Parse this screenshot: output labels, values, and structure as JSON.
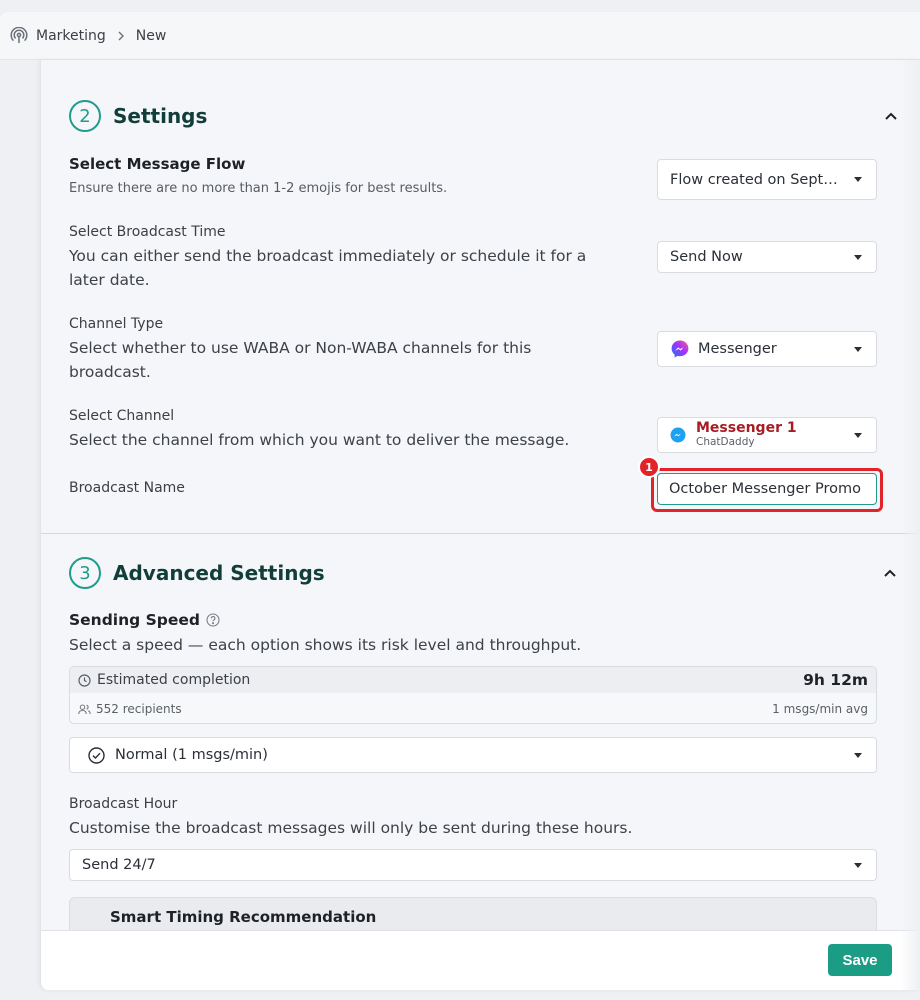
{
  "breadcrumb": {
    "section": "Marketing",
    "current": "New"
  },
  "settings": {
    "step": "2",
    "title": "Settings",
    "message_flow": {
      "label": "Select Message Flow",
      "description": "Ensure there are no more than 1-2 emojis for best results.",
      "value": "Flow created on September"
    },
    "broadcast_time": {
      "label": "Select Broadcast Time",
      "description": "You can either send the broadcast immediately or schedule it for a later date.",
      "value": "Send Now"
    },
    "channel_type": {
      "label": "Channel Type",
      "description": "Select whether to use WABA or Non-WABA channels for this broadcast.",
      "value": "Messenger"
    },
    "channel": {
      "label": "Select Channel",
      "description": "Select the channel from which you want to deliver the message.",
      "name": "Messenger 1",
      "sub": "ChatDaddy"
    },
    "broadcast_name": {
      "label": "Broadcast Name",
      "value": "October Messenger Promo",
      "annotation": "1"
    }
  },
  "advanced": {
    "step": "3",
    "title": "Advanced Settings",
    "speed": {
      "label": "Sending Speed",
      "description": "Select a speed — each option shows its risk level and throughput.",
      "estimate_label": "Estimated completion",
      "estimate_time": "9h 12m",
      "recipients": "552 recipients",
      "rate": "1 msgs/min avg",
      "value": "Normal (1 msgs/min)"
    },
    "hour": {
      "label": "Broadcast Hour",
      "description": "Customise the broadcast messages will only be sent during these hours.",
      "value": "Send 24/7"
    },
    "smart_timing": "Smart Timing Recommendation"
  },
  "footer": {
    "save_label": "Save"
  },
  "colors": {
    "accent": "#1a9c85",
    "highlight": "#e0242a",
    "channel_red": "#a61d24"
  }
}
